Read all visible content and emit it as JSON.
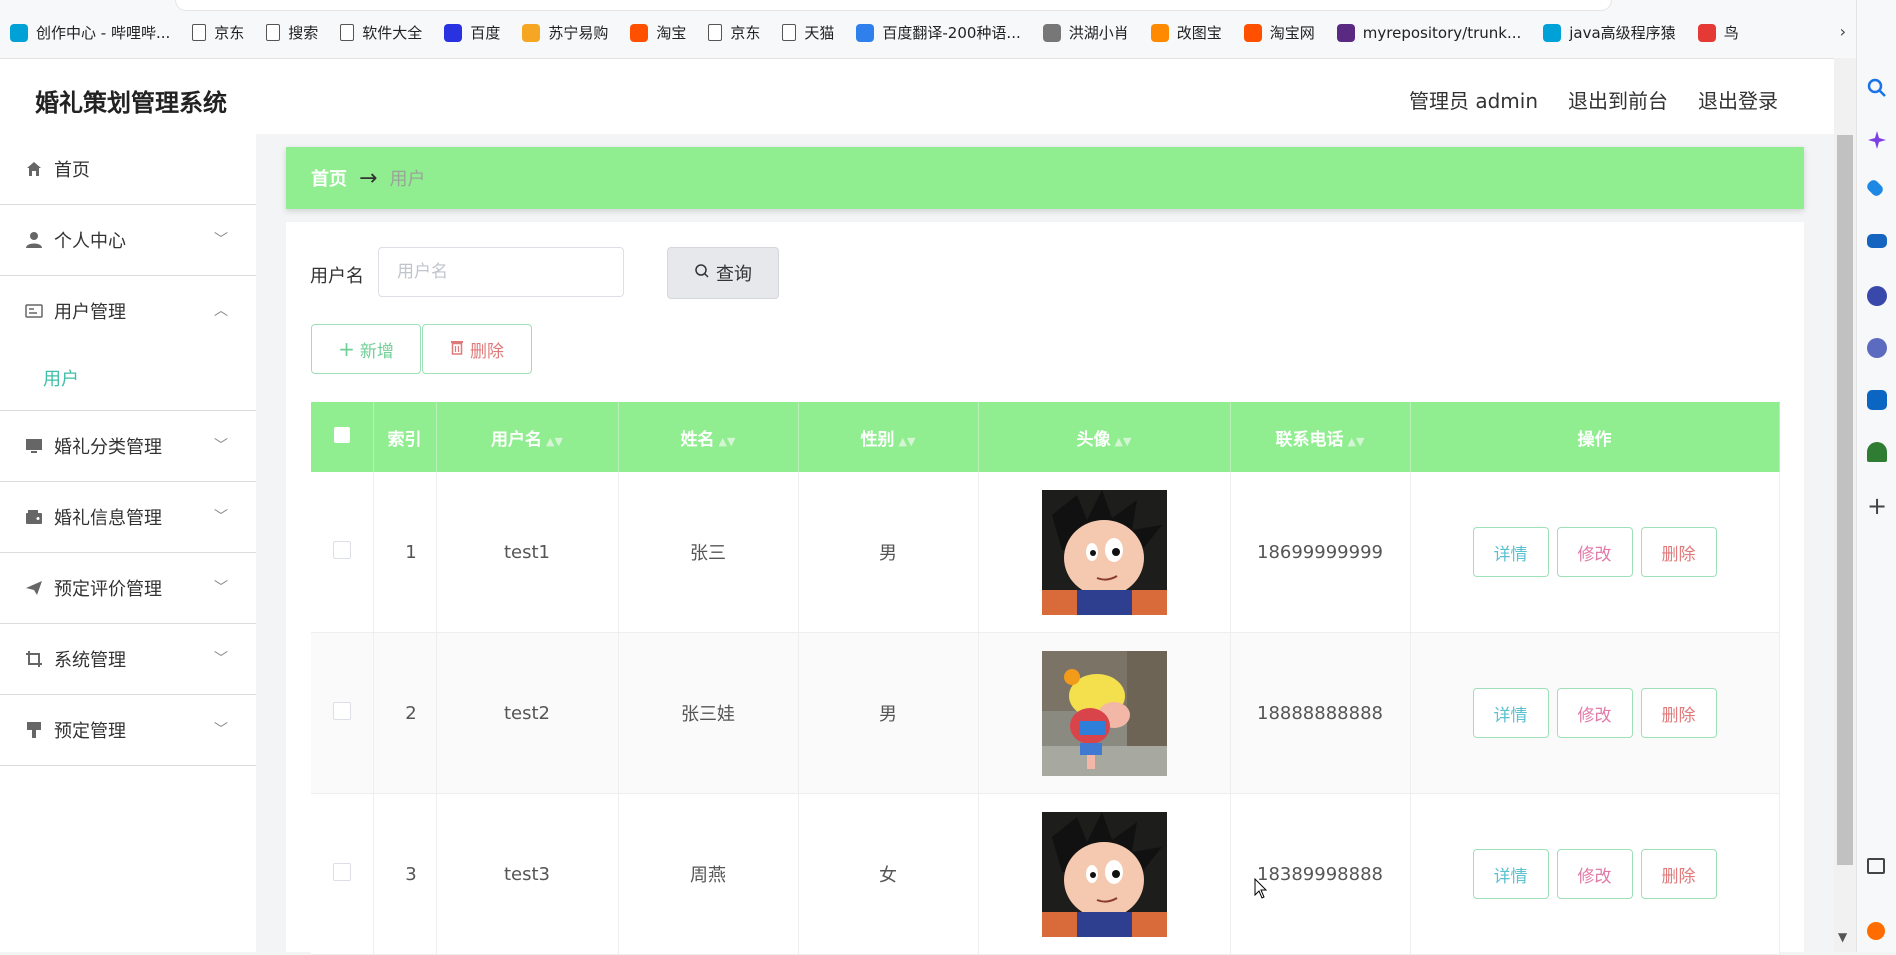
{
  "bookmarks": [
    {
      "label": "创作中心 - 哔哩哔...",
      "icon": "bilibili-icon",
      "color": "#00a1d6"
    },
    {
      "label": "京东",
      "icon": "page-icon"
    },
    {
      "label": "搜索",
      "icon": "page-icon"
    },
    {
      "label": "软件大全",
      "icon": "page-icon"
    },
    {
      "label": "百度",
      "icon": "baidu-paw-icon",
      "color": "#2932e1"
    },
    {
      "label": "苏宁易购",
      "icon": "suning-icon",
      "color": "#f5a623"
    },
    {
      "label": "淘宝",
      "icon": "taobao-icon",
      "color": "#ff5000"
    },
    {
      "label": "京东",
      "icon": "page-icon"
    },
    {
      "label": "天猫",
      "icon": "page-icon"
    },
    {
      "label": "百度翻译-200种语...",
      "icon": "translate-icon",
      "color": "#2f80ed"
    },
    {
      "label": "洪湖小肖",
      "icon": "bird-icon",
      "color": "#777777"
    },
    {
      "label": "改图宝",
      "icon": "gaitubao-icon",
      "color": "#ff8a00"
    },
    {
      "label": "淘宝网",
      "icon": "taobao-icon",
      "color": "#ff5000"
    },
    {
      "label": "myrepository/trunk...",
      "icon": "repo-icon",
      "color": "#5a2a82"
    },
    {
      "label": "java高级程序猿",
      "icon": "bilibili-icon",
      "color": "#00a1d6"
    },
    {
      "label": "鸟",
      "icon": "swallow-icon",
      "color": "#e53935"
    }
  ],
  "app": {
    "title": "婚礼策划管理系统",
    "header_actions": [
      "管理员 admin",
      "退出到前台",
      "退出登录"
    ]
  },
  "sidebar": {
    "items": [
      {
        "label": "首页",
        "icon": "home-icon"
      },
      {
        "label": "个人中心",
        "icon": "user-icon"
      },
      {
        "label": "用户管理",
        "icon": "id-card-icon"
      },
      {
        "label": "婚礼分类管理",
        "icon": "monitor-icon"
      },
      {
        "label": "婚礼信息管理",
        "icon": "wallet-icon"
      },
      {
        "label": "预定评价管理",
        "icon": "send-icon"
      },
      {
        "label": "系统管理",
        "icon": "crop-icon"
      },
      {
        "label": "预定管理",
        "icon": "brush-icon"
      }
    ],
    "sub_item": "用户"
  },
  "breadcrumb": {
    "home": "首页",
    "arrow": "→",
    "current": "用户"
  },
  "search": {
    "label": "用户名",
    "placeholder": "用户名",
    "button": "查询"
  },
  "toolbar": {
    "add": "新增",
    "delete": "删除"
  },
  "table": {
    "headers": [
      "索引",
      "用户名",
      "姓名",
      "性别",
      "头像",
      "联系电话",
      "操作"
    ],
    "rows": [
      {
        "index": "1",
        "username": "test1",
        "name": "张三",
        "gender": "男",
        "phone": "18699999999",
        "avatar": "goku"
      },
      {
        "index": "2",
        "username": "test2",
        "name": "张三娃",
        "gender": "男",
        "phone": "18888888888",
        "avatar": "oolong"
      },
      {
        "index": "3",
        "username": "test3",
        "name": "周燕",
        "gender": "女",
        "phone": "18389998888",
        "avatar": "goku"
      }
    ],
    "actions": {
      "detail": "详情",
      "edit": "修改",
      "remove": "删除"
    }
  },
  "colors": {
    "accent_green": "#90ee90",
    "teal": "#3fbfa7"
  }
}
